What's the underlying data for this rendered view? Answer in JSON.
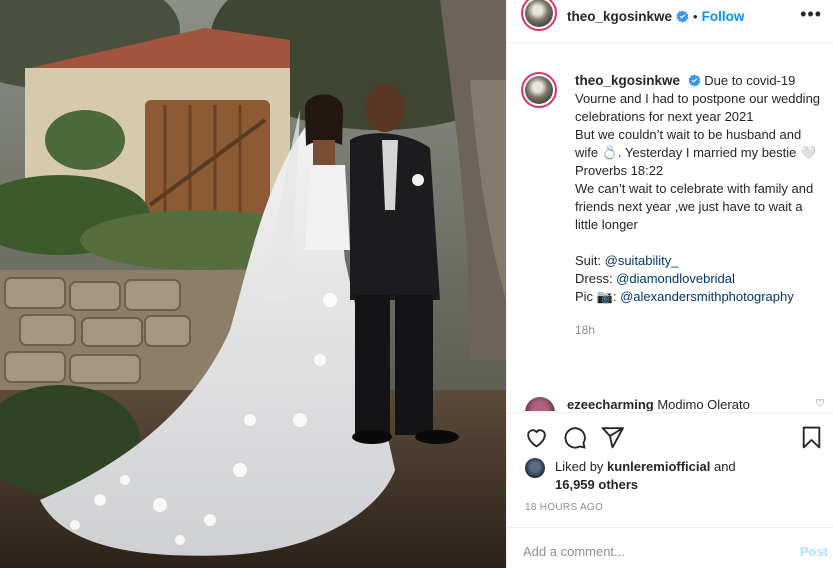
{
  "header": {
    "username": "theo_kgosinkwe",
    "separator": "•",
    "follow_label": "Follow",
    "more_label": "•••"
  },
  "caption": {
    "username": "theo_kgosinkwe",
    "lines": [
      "Due to covid-19 Vourne and I had to postpone our wedding celebrations for next year 2021",
      "But we couldn’t wait to be husband and wife 💍. Yesterday I married my bestie 🤍",
      "Proverbs 18:22",
      "We can’t wait to celebrate with family and friends next year ,we just have to wait a little longer"
    ],
    "credits": [
      {
        "label": "Suit: ",
        "handle": "@suitability_"
      },
      {
        "label": "Dress: ",
        "handle": "@diamondlovebridal"
      },
      {
        "label": "Pic 📷: ",
        "handle": "@alexandersmithphotography"
      }
    ],
    "time": "18h"
  },
  "comment_preview": {
    "username": "ezeecharming",
    "text": "Modimo Olerato"
  },
  "actions": {
    "like": "heart-icon",
    "comment": "comment-icon",
    "share": "paper-plane-icon",
    "save": "bookmark-icon"
  },
  "likes": {
    "prefix": "Liked by ",
    "liker": "kunleremiofficial",
    "and": " and",
    "others": "16,959 others"
  },
  "posted": "18 HOURS AGO",
  "add_comment": {
    "placeholder": "Add a comment...",
    "post_label": "Post"
  },
  "colors": {
    "accent": "#0095f6",
    "link": "#00376b",
    "muted": "#8e8e8e",
    "post_disabled": "#b2dffc",
    "story_ring": "#e1306c"
  }
}
